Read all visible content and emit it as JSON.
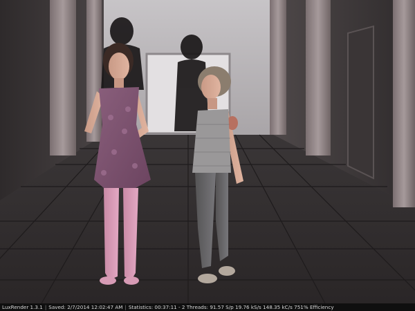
{
  "app": {
    "name": "LuxRender 1.3.1"
  },
  "status": {
    "saved": "Saved: 2/7/2014 12:02:47 AM",
    "statistics": "Statistics: 00:37:11 - 2 Threads: 91.57 S/p 19.76 kS/s 148.35 kC/s 751% Efficiency",
    "separator": "|"
  },
  "colors": {
    "status_bg": "#0f0f0f",
    "status_text": "#d8d8d8"
  }
}
